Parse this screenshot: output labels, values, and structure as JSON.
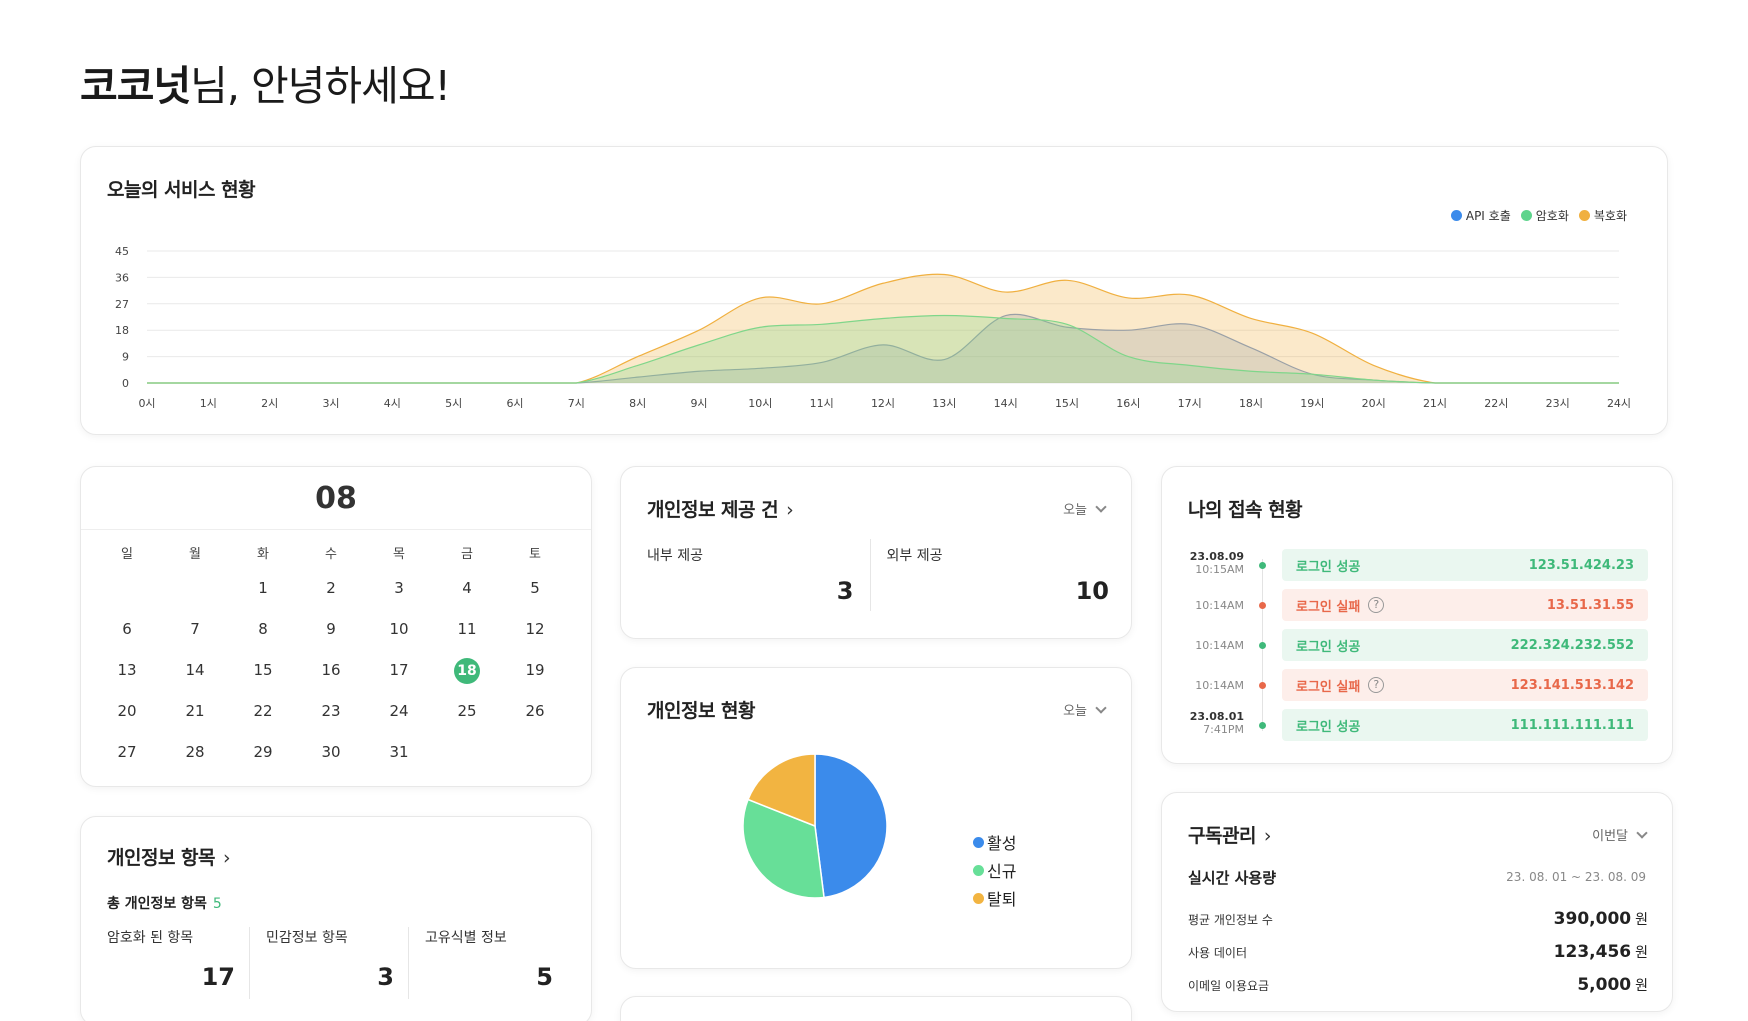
{
  "greeting": {
    "name": "코코넛",
    "suffix": "님, 안녕하세요!"
  },
  "service": {
    "title": "오늘의 서비스 현황",
    "legend": [
      {
        "label": "API 호출",
        "color": "#3b8beb"
      },
      {
        "label": "암호화",
        "color": "#5ed48c"
      },
      {
        "label": "복호화",
        "color": "#f0b040"
      }
    ],
    "chart_data": {
      "type": "area",
      "x": [
        "0시",
        "1시",
        "2시",
        "3시",
        "4시",
        "5시",
        "6시",
        "7시",
        "8시",
        "9시",
        "10시",
        "11시",
        "12시",
        "13시",
        "14시",
        "15시",
        "16시",
        "17시",
        "18시",
        "19시",
        "20시",
        "21시",
        "22시",
        "23시",
        "24시"
      ],
      "ylim": [
        0,
        45
      ],
      "yticks": [
        0,
        9,
        18,
        27,
        36,
        45
      ],
      "grid": true,
      "legend_position": "top-right",
      "series": [
        {
          "name": "복호화",
          "color": "#f0b040",
          "values": [
            0,
            0,
            0,
            0,
            0,
            0,
            0,
            0,
            9,
            18,
            29,
            27,
            34,
            37,
            31,
            35,
            29,
            30,
            22,
            17,
            6,
            0,
            0,
            0,
            0
          ]
        },
        {
          "name": "API 호출",
          "color": "#9aa0a6",
          "values": [
            0,
            0,
            0,
            0,
            0,
            0,
            0,
            0,
            2,
            4,
            5,
            7,
            13,
            8,
            23,
            19,
            18,
            20,
            12,
            3,
            1,
            0,
            0,
            0,
            0
          ]
        },
        {
          "name": "암호화",
          "color": "#7fd68a",
          "values": [
            0,
            0,
            0,
            0,
            0,
            0,
            0,
            0,
            6,
            13,
            19,
            20,
            22,
            23,
            22,
            20,
            9,
            6,
            4,
            3,
            1,
            0,
            0,
            0,
            0
          ]
        }
      ]
    }
  },
  "calendar": {
    "month": "08",
    "weekdays": [
      "일",
      "월",
      "화",
      "수",
      "목",
      "금",
      "토"
    ],
    "days": [
      "",
      "",
      "1",
      "2",
      "3",
      "4",
      "5",
      "6",
      "7",
      "8",
      "9",
      "10",
      "11",
      "12",
      "13",
      "14",
      "15",
      "16",
      "17",
      "18",
      "19",
      "20",
      "21",
      "22",
      "23",
      "24",
      "25",
      "26",
      "27",
      "28",
      "29",
      "30",
      "31"
    ],
    "today": "18"
  },
  "items": {
    "title": "개인정보 항목",
    "total_label": "총 개인정보 항목",
    "total_value": "5",
    "cols": [
      {
        "label": "암호화 된 항목",
        "value": "17"
      },
      {
        "label": "민감정보 항목",
        "value": "3"
      },
      {
        "label": "고유식별 정보",
        "value": "5"
      }
    ]
  },
  "provision": {
    "title": "개인정보 제공 건",
    "period": "오늘",
    "cols": [
      {
        "label": "내부 제공",
        "value": "3"
      },
      {
        "label": "외부 제공",
        "value": "10"
      }
    ]
  },
  "status": {
    "title": "개인정보 현황",
    "period": "오늘",
    "chart_data": {
      "type": "pie",
      "slices": [
        {
          "label": "활성",
          "value": 48,
          "color": "#3b8beb"
        },
        {
          "label": "신규",
          "value": 33,
          "color": "#67df98"
        },
        {
          "label": "탈퇴",
          "value": 19,
          "color": "#f2b441"
        }
      ]
    }
  },
  "access": {
    "title": "나의 접속 현황",
    "rows": [
      {
        "date": "23.08.09",
        "time": "10:15AM",
        "status": "로그인 성공",
        "ip": "123.51.424.23",
        "ok": true
      },
      {
        "date": "",
        "time": "10:14AM",
        "status": "로그인 실패",
        "ip": "13.51.31.55",
        "ok": false
      },
      {
        "date": "",
        "time": "10:14AM",
        "status": "로그인 성공",
        "ip": "222.324.232.552",
        "ok": true
      },
      {
        "date": "",
        "time": "10:14AM",
        "status": "로그인 실패",
        "ip": "123.141.513.142",
        "ok": false
      },
      {
        "date": "23.08.01",
        "time": "7:41PM",
        "status": "로그인 성공",
        "ip": "111.111.111.111",
        "ok": true
      }
    ],
    "help_glyph": "?"
  },
  "subscription": {
    "title": "구독관리",
    "period": "이번달",
    "realtime_label": "실시간 사용량",
    "range": "23. 08. 01 ~ 23. 08. 09",
    "unit": "원",
    "rows": [
      {
        "label": "평균 개인정보 수",
        "value": "390,000"
      },
      {
        "label": "사용 데이터",
        "value": "123,456"
      },
      {
        "label": "이메일 이용요금",
        "value": "5,000"
      }
    ]
  },
  "icons": {
    "chevron_right": "›",
    "chevron_down": "chevron-down-icon"
  }
}
